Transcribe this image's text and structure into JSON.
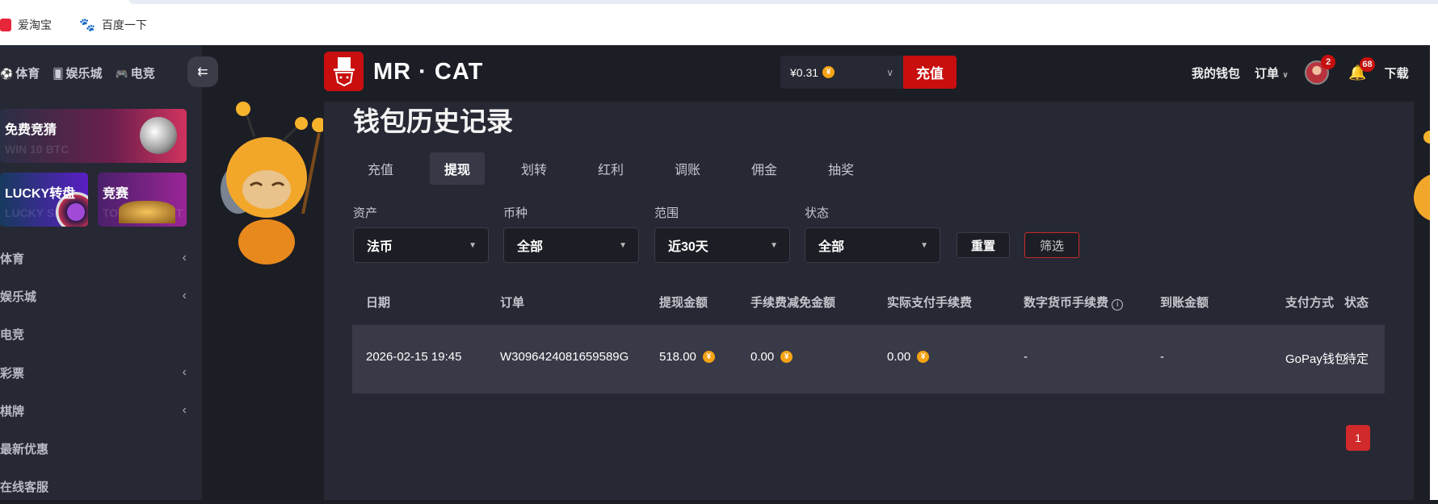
{
  "bookmarks": [
    {
      "label": "爱淘宝",
      "icon": "taobao-icon",
      "color": "#e8263a"
    },
    {
      "label": "百度一下",
      "icon": "baidu-paw-icon",
      "color": "#2932e1"
    }
  ],
  "top_nav": [
    {
      "label": "体育",
      "icon": "soccer-ball-icon"
    },
    {
      "label": "娱乐城",
      "icon": "cards-icon"
    },
    {
      "label": "电竞",
      "icon": "gamepad-icon"
    }
  ],
  "collapse_icon": "collapse-left-icon",
  "banners": [
    {
      "title": "免费竞猜",
      "subtitle": "WIN 10 BTC"
    },
    {
      "title": "LUCKY转盘",
      "subtitle": "LUCKY SPIN"
    },
    {
      "title": "竞赛",
      "subtitle": "TOURNAMENT"
    }
  ],
  "sidebar": {
    "items": [
      {
        "label": "体育",
        "chevron": true
      },
      {
        "label": "娱乐城",
        "chevron": true
      },
      {
        "label": "电竞",
        "chevron": false
      },
      {
        "label": "彩票",
        "chevron": true
      },
      {
        "label": "棋牌",
        "chevron": true
      },
      {
        "label": "最新优惠",
        "chevron": false
      },
      {
        "label": "在线客服",
        "chevron": false
      }
    ]
  },
  "header": {
    "brand": "MR · CAT",
    "balance": "¥0.31",
    "coin_symbol": "¥",
    "deposit_label": "充值",
    "my_wallet": "我的钱包",
    "orders": "订单",
    "avatar_badge": "2",
    "notification_badge": "68",
    "download": "下载"
  },
  "page": {
    "title": "钱包历史记录",
    "tabs": [
      {
        "label": "充值",
        "active": false
      },
      {
        "label": "提现",
        "active": true
      },
      {
        "label": "划转",
        "active": false
      },
      {
        "label": "红利",
        "active": false
      },
      {
        "label": "调账",
        "active": false
      },
      {
        "label": "佣金",
        "active": false
      },
      {
        "label": "抽奖",
        "active": false
      }
    ]
  },
  "filters": [
    {
      "label": "资产",
      "value": "法币"
    },
    {
      "label": "币种",
      "value": "全部"
    },
    {
      "label": "范围",
      "value": "近30天"
    },
    {
      "label": "状态",
      "value": "全部"
    }
  ],
  "buttons": {
    "reset": "重置",
    "filter": "筛选"
  },
  "table": {
    "columns": [
      "日期",
      "订单",
      "提现金额",
      "手续费减免金额",
      "实际支付手续费",
      "数字货币手续费",
      "到账金额",
      "支付方式",
      "状态"
    ],
    "rows": [
      [
        "2026-02-15 19:45",
        "W3096424081659589G",
        "518.00",
        "0.00",
        "0.00",
        "-",
        "-",
        "GoPay钱包",
        "待定"
      ]
    ]
  },
  "pagination": {
    "current": "1"
  },
  "colors": {
    "accent": "#c80e0e",
    "coin": "#f5a314",
    "panel": "#262833",
    "row": "#383a47"
  }
}
